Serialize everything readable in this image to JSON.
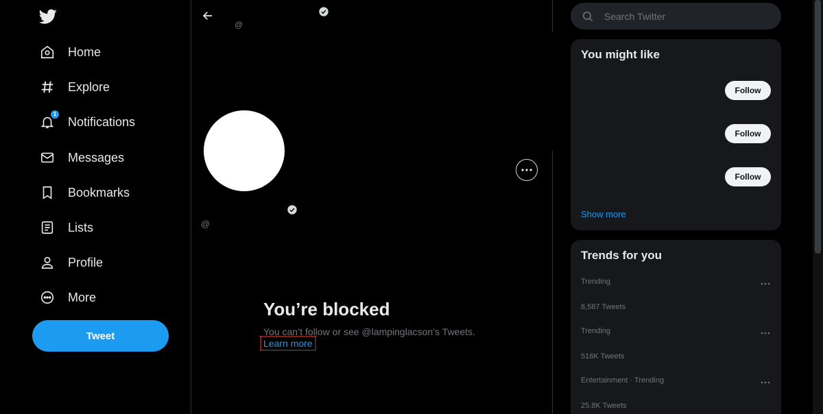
{
  "sidebar": {
    "items": [
      {
        "label": "Home",
        "icon": "home-icon"
      },
      {
        "label": "Explore",
        "icon": "hashtag-icon"
      },
      {
        "label": "Notifications",
        "icon": "bell-icon",
        "badge": "1"
      },
      {
        "label": "Messages",
        "icon": "envelope-icon"
      },
      {
        "label": "Bookmarks",
        "icon": "bookmark-icon"
      },
      {
        "label": "Lists",
        "icon": "list-icon"
      },
      {
        "label": "Profile",
        "icon": "person-icon"
      },
      {
        "label": "More",
        "icon": "more-circle-icon"
      }
    ],
    "tweet_label": "Tweet"
  },
  "profile": {
    "handle_top": "@",
    "handle": "@",
    "blocked_title": "You’re blocked",
    "blocked_desc": "You can’t follow or see @lampinglacson’s Tweets.",
    "learn_more": "Learn more"
  },
  "search": {
    "placeholder": "Search Twitter"
  },
  "might_like": {
    "title": "You might like",
    "follow_labels": [
      "Follow",
      "Follow",
      "Follow"
    ],
    "show_more": "Show more"
  },
  "trends": {
    "title": "Trends for you",
    "items": [
      {
        "meta": "Trending",
        "count": "8,587 Tweets"
      },
      {
        "meta": "Trending",
        "count": "516K Tweets"
      },
      {
        "meta": "Entertainment · Trending",
        "count": "25.8K Tweets"
      }
    ]
  },
  "colors": {
    "accent": "#1d9bf0",
    "background": "#000000",
    "card": "#16181c"
  }
}
